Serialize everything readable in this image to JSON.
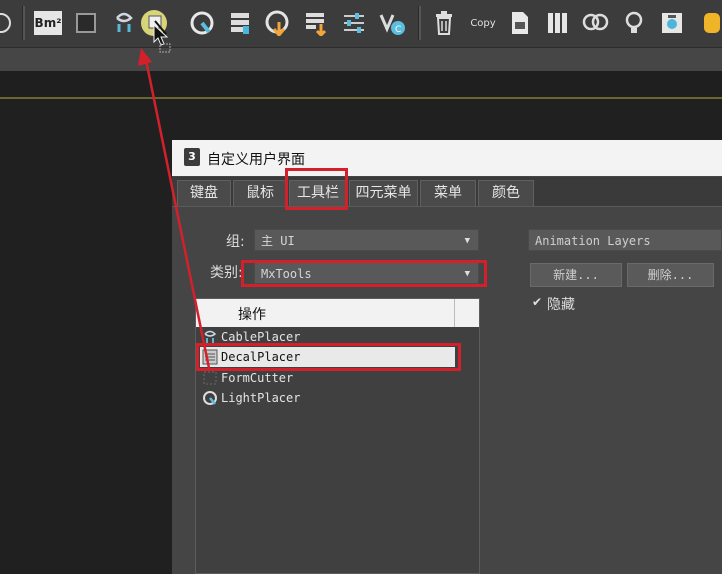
{
  "toolbar": {
    "bitmap_label": "Bm²",
    "copy_label": "Copy"
  },
  "dialog": {
    "app_icon_label": "3",
    "title": "自定义用户界面",
    "tabs": [
      "键盘",
      "鼠标",
      "工具栏",
      "四元菜单",
      "菜单",
      "颜色"
    ],
    "active_tab": "工具栏",
    "group_label": "组:",
    "group_value": "主 UI",
    "category_label": "类别:",
    "category_value": "MxTools",
    "actions_header": "操作",
    "actions": [
      "CablePlacer",
      "DecalPlacer",
      "FormCutter",
      "LightPlacer"
    ],
    "selected_action": "DecalPlacer",
    "toolbar_select_value": "Animation Layers",
    "new_button": "新建...",
    "delete_button": "删除...",
    "hide_checkbox_label": "隐藏",
    "hide_checked": true
  },
  "colors": {
    "highlight": "#d3202a",
    "toolbar_bg": "#3c3c3c",
    "dialog_bg": "#454545"
  }
}
